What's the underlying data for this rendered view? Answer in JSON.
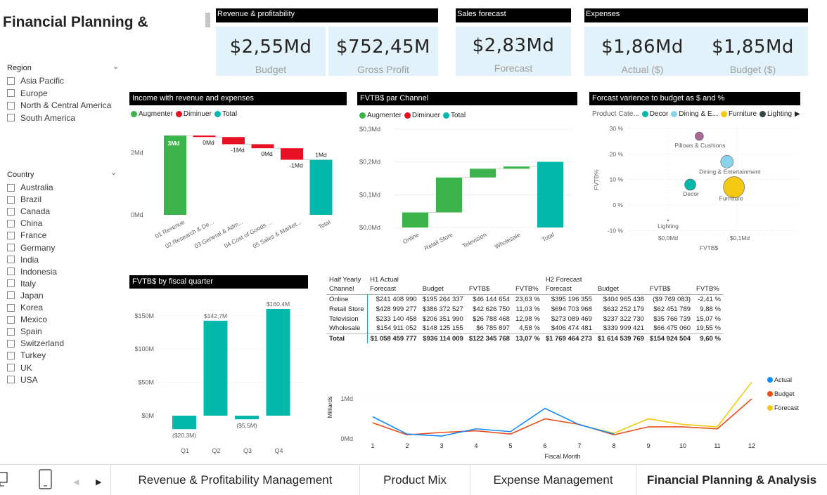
{
  "page": {
    "title": "Financial Planning &"
  },
  "region_slicer": {
    "title": "Region",
    "options": [
      "Asia Pacific",
      "Europe",
      "North & Central America",
      "South America"
    ]
  },
  "country_slicer": {
    "title": "Country",
    "options": [
      "Australia",
      "Brazil",
      "Canada",
      "China",
      "France",
      "Germany",
      "India",
      "Indonesia",
      "Italy",
      "Japan",
      "Korea",
      "Mexico",
      "Spain",
      "Switzerland",
      "Turkey",
      "UK",
      "USA"
    ]
  },
  "cards": {
    "revenue": {
      "title": "Revenue & profitability",
      "budget_value": "$2,55Md",
      "budget_label": "Budget",
      "gross_value": "$752,45M",
      "gross_label": "Gross Profit"
    },
    "sales": {
      "title": "Sales forecast",
      "value": "$2,83Md",
      "label": "Forecast"
    },
    "expenses": {
      "title": "Expenses",
      "actual_value": "$1,86Md",
      "actual_label": "Actual ($)",
      "budget_value": "$1,85Md",
      "budget_label": "Budget ($)"
    }
  },
  "colors": {
    "increase": "#3cb44b",
    "decrease": "#e81123",
    "total": "#01b8aa",
    "actual": "#118dff",
    "budget": "#e8501a",
    "forecast": "#f2c811",
    "card_bg": "#e1f2fa"
  },
  "legend_waterfall": [
    "Augmenter",
    "Diminuer",
    "Total"
  ],
  "chart_data": [
    {
      "id": "income_waterfall",
      "type": "waterfall",
      "title": "Income with revenue and expenses",
      "categories": [
        "01 Revenue",
        "02 Research & De...",
        "03 General & Adm...",
        "04 Cost of Goods ...",
        "05 Sales & Market...",
        "Total"
      ],
      "values": [
        2.55,
        -0.05,
        -0.23,
        -0.13,
        -0.37,
        1.77
      ],
      "kinds": [
        "increase",
        "decrease",
        "decrease",
        "decrease",
        "decrease",
        "total"
      ],
      "data_labels": [
        "3Md",
        "0Md",
        "-1Md",
        "0Md",
        "-1Md",
        "1Md"
      ],
      "y_ticks": [
        "0Md",
        "2Md"
      ],
      "ylim": [
        0,
        3.0
      ]
    },
    {
      "id": "channel_waterfall",
      "type": "waterfall",
      "title": "FVTB$ par Channel",
      "categories": [
        "Online",
        "Retail Store",
        "Television",
        "Wholesale",
        "Total"
      ],
      "values": [
        0.046,
        0.1066,
        0.0268,
        0.0068,
        0.2004
      ],
      "kinds": [
        "increase",
        "increase",
        "increase",
        "increase",
        "total"
      ],
      "y_ticks": [
        "$0,0Md",
        "$0,1Md",
        "$0,2Md",
        "$0,3Md"
      ],
      "ylim": [
        0,
        0.3
      ]
    },
    {
      "id": "variance_scatter",
      "type": "scatter",
      "title": "Forcast varience to budget as $ and %",
      "legend_title": "Product Cate...",
      "legend": [
        {
          "name": "Decor",
          "color": "#01b8aa"
        },
        {
          "name": "Dining & E...",
          "color": "#8ad4eb"
        },
        {
          "name": "Furniture",
          "color": "#f2c811"
        },
        {
          "name": "Lighting",
          "color": "#374649"
        }
      ],
      "points": [
        {
          "name": "Pillows & Cushions",
          "x": 0.045,
          "y": 27,
          "r": 6,
          "color": "#a66999"
        },
        {
          "name": "Dining & Entertainment",
          "x": 0.085,
          "y": 17,
          "r": 9,
          "color": "#8ad4eb"
        },
        {
          "name": "Decor",
          "x": 0.032,
          "y": 8,
          "r": 8,
          "color": "#01b8aa"
        },
        {
          "name": "Furniture",
          "x": 0.095,
          "y": 7,
          "r": 15,
          "color": "#f2c811"
        },
        {
          "name": "Lighting",
          "x": 0.0,
          "y": -6,
          "r": 1,
          "color": "#374649"
        }
      ],
      "y_ticks": [
        "30 %",
        "20 %",
        "10 %",
        "0 %",
        "-10 %"
      ],
      "x_ticks": [
        "$0,0Md",
        "$0,1Md"
      ],
      "xlabel": "FVTB$",
      "ylabel": "FVTB%"
    },
    {
      "id": "quarter_bars",
      "type": "bar",
      "title": "FVTB$ by fiscal quarter",
      "categories": [
        "Q1",
        "Q2",
        "Q3",
        "Q4"
      ],
      "values": [
        -20.3,
        142.7,
        -5.5,
        160.4
      ],
      "data_labels": [
        "($20,3M)",
        "$142,7M",
        "($5,5M)",
        "$160,4M"
      ],
      "y_ticks": [
        "$0M",
        "$50M",
        "$100M",
        "$150M"
      ],
      "ylim": [
        -30,
        170
      ]
    },
    {
      "id": "monthly_lines",
      "type": "line",
      "x": [
        1,
        2,
        3,
        4,
        5,
        6,
        7,
        8,
        9,
        10,
        11,
        12
      ],
      "x_ticks": [
        "1",
        "2",
        "3",
        "4",
        "5",
        "6",
        "7",
        "8",
        "9",
        "10",
        "11",
        "12"
      ],
      "xlabel": "Fiscal Month",
      "ylabel": "Milliards",
      "y_ticks": [
        "0Md",
        "1Md"
      ],
      "ylim": [
        0,
        1.6
      ],
      "series": [
        {
          "name": "Actual",
          "color": "#118dff",
          "values": [
            0.55,
            0.12,
            0.07,
            0.25,
            0.18,
            0.76,
            0.35,
            0.12,
            null,
            null,
            null,
            null
          ]
        },
        {
          "name": "Budget",
          "color": "#e8501a",
          "values": [
            0.4,
            0.1,
            0.16,
            0.2,
            0.12,
            0.5,
            0.36,
            0.1,
            0.3,
            0.3,
            0.25,
            1.0
          ]
        },
        {
          "name": "Forecast",
          "color": "#f2c811",
          "values": [
            null,
            null,
            null,
            null,
            null,
            0.76,
            0.35,
            0.14,
            0.5,
            0.36,
            0.3,
            1.42
          ]
        }
      ]
    }
  ],
  "matrix": {
    "headers_top": [
      "Half Yearly",
      "H1 Actual",
      "",
      "",
      "",
      "H2 Forecast",
      "",
      "",
      ""
    ],
    "headers": [
      "Channel",
      "Forecast",
      "Budget",
      "FVTB$",
      "FVTB%",
      "Forecast",
      "Budget",
      "FVTB$",
      "FVTB%"
    ],
    "rows": [
      [
        "Online",
        "$241 408 990",
        "$195 264 337",
        "$46 144 654",
        "23,63 %",
        "$395 196 355",
        "$404 965 438",
        "($9 769 083)",
        "-2,41 %"
      ],
      [
        "Retail Store",
        "$428 999 277",
        "$386 372 527",
        "$42 626 750",
        "11,03 %",
        "$694 703 968",
        "$632 252 179",
        "$62 451 789",
        "9,88 %"
      ],
      [
        "Television",
        "$233 140 458",
        "$206 351 990",
        "$26 788 468",
        "12,98 %",
        "$273 089 469",
        "$237 322 730",
        "$35 766 739",
        "15,07 %"
      ],
      [
        "Wholesale",
        "$154 911 052",
        "$148 125 155",
        "$6 785 897",
        "4,58 %",
        "$406 474 481",
        "$339 999 421",
        "$66 475 060",
        "19,55 %"
      ],
      [
        "Total",
        "$1 058 459 777",
        "$936 114 009",
        "$122 345 768",
        "13,07 %",
        "$1 769 464 273",
        "$1 614 539 769",
        "$154 924 504",
        "9,60 %"
      ]
    ]
  },
  "tabs": [
    "Revenue & Profitability Management",
    "Product Mix",
    "Expense Management",
    "Financial Planning & Analysis"
  ],
  "active_tab": 3
}
